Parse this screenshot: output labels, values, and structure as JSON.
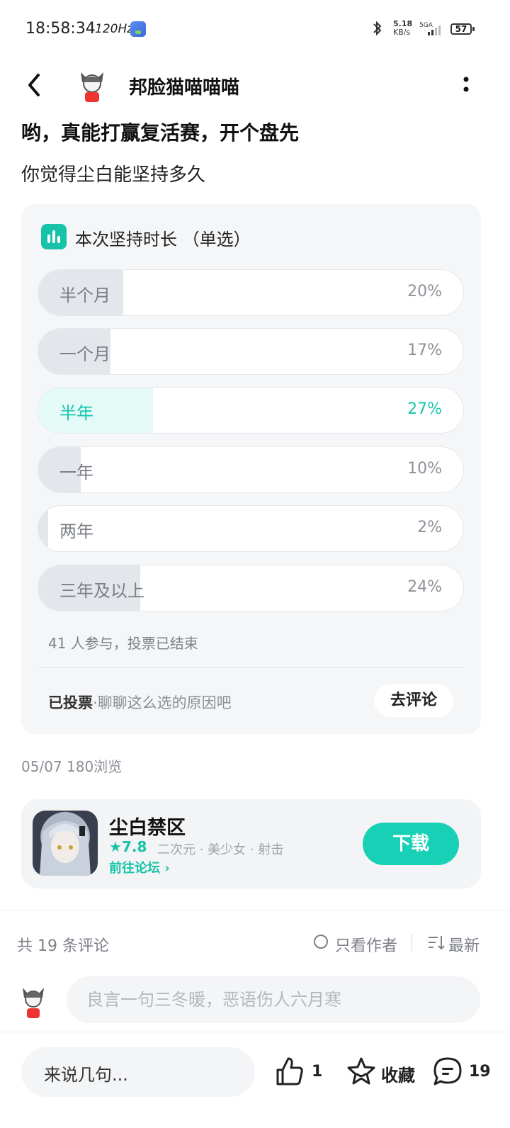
{
  "status_bar": {
    "time": "18:58:34",
    "refresh_rate": "120Hz",
    "net_speed_value": "5.18",
    "net_speed_unit": "KB/s",
    "network": "5GA",
    "battery": "57"
  },
  "header": {
    "author_name": "邦脸猫喵喵喵"
  },
  "post": {
    "title": "哟，真能打赢复活赛，开个盘先",
    "body": "你觉得尘白能坚持多久",
    "meta": "05/07  180浏览"
  },
  "poll": {
    "title": "本次坚持时长 （单选）",
    "options": [
      {
        "label": "半个月",
        "percent_text": "20%",
        "fill": 0.2,
        "selected": false
      },
      {
        "label": "一个月",
        "percent_text": "17%",
        "fill": 0.17,
        "selected": false
      },
      {
        "label": "半年",
        "percent_text": "27%",
        "fill": 0.27,
        "selected": true
      },
      {
        "label": "一年",
        "percent_text": "10%",
        "fill": 0.1,
        "selected": false
      },
      {
        "label": "两年",
        "percent_text": "2%",
        "fill": 0.02,
        "selected": false
      },
      {
        "label": "三年及以上",
        "percent_text": "24%",
        "fill": 0.24,
        "selected": false
      }
    ],
    "stats": "41 人参与，投票已结束",
    "voted_label": "已投票",
    "voted_hint": "·聊聊这么选的原因吧",
    "comment_button": "去评论"
  },
  "game": {
    "name": "尘白禁区",
    "score": "★7.8",
    "tags": "二次元 · 美少女 · 射击",
    "forum_link": "前往论坛 ›",
    "download": "下载"
  },
  "comments": {
    "count": "共 19 条评论",
    "only_author": "只看作者",
    "sort": "最新",
    "input_placeholder": "良言一句三冬暖，恶语伤人六月寒"
  },
  "bottom_bar": {
    "quick_comment": "来说几句...",
    "likes": "1",
    "favorite": "收藏",
    "comment_count": "19"
  },
  "colors": {
    "accent": "#17c3a8",
    "download_button": "#17d0b5"
  },
  "icons": [
    "back-icon",
    "more-icon",
    "poll-chart-icon",
    "bluetooth-icon",
    "signal-icon",
    "battery-icon",
    "sort-icon",
    "like-icon",
    "favorite-star-icon",
    "comment-bubble-icon"
  ]
}
